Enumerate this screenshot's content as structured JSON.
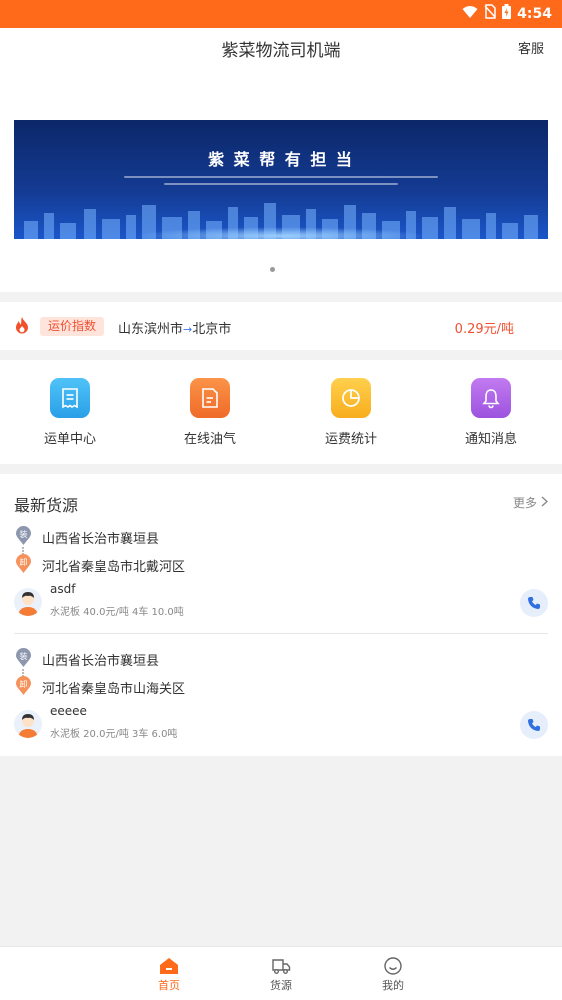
{
  "status_bar": {
    "time": "4:54"
  },
  "header": {
    "title": "紫菜物流司机端",
    "service_label": "客服"
  },
  "banner": {
    "slogan": "紫 菜 帮   有 担 当"
  },
  "price_index": {
    "tag": "运价指数",
    "origin": "山东滨州市",
    "arrow": "→",
    "destination": "北京市",
    "price": "0.29元/吨"
  },
  "menu": {
    "items": [
      {
        "label": "运单中心",
        "icon": "waybill-icon",
        "color": "#36b7f0"
      },
      {
        "label": "在线油气",
        "icon": "document-icon",
        "color": "#f47c34"
      },
      {
        "label": "运费统计",
        "icon": "pie-chart-icon",
        "color": "#fbbd2e"
      },
      {
        "label": "通知消息",
        "icon": "bell-icon",
        "color": "#b065e6"
      }
    ]
  },
  "cargo_section": {
    "title": "最新货源",
    "more_label": "更多",
    "load_badge": "装",
    "unload_badge": "卸",
    "items": [
      {
        "from": "山西省长治市襄垣县",
        "to": "河北省秦皇岛市北戴河区",
        "name": "asdf",
        "meta": "水泥板 40.0元/吨 4车 10.0吨"
      },
      {
        "from": "山西省长治市襄垣县",
        "to": "河北省秦皇岛市山海关区",
        "name": "eeeee",
        "meta": "水泥板 20.0元/吨 3车 6.0吨"
      }
    ]
  },
  "tabbar": {
    "tabs": [
      {
        "label": "首页",
        "icon": "home-icon",
        "active": true
      },
      {
        "label": "货源",
        "icon": "truck-icon",
        "active": false
      },
      {
        "label": "我的",
        "icon": "smiley-icon",
        "active": false
      }
    ]
  },
  "colors": {
    "brand": "#ff6a1a",
    "price": "#f05030",
    "phone": "#2f6fe0"
  }
}
